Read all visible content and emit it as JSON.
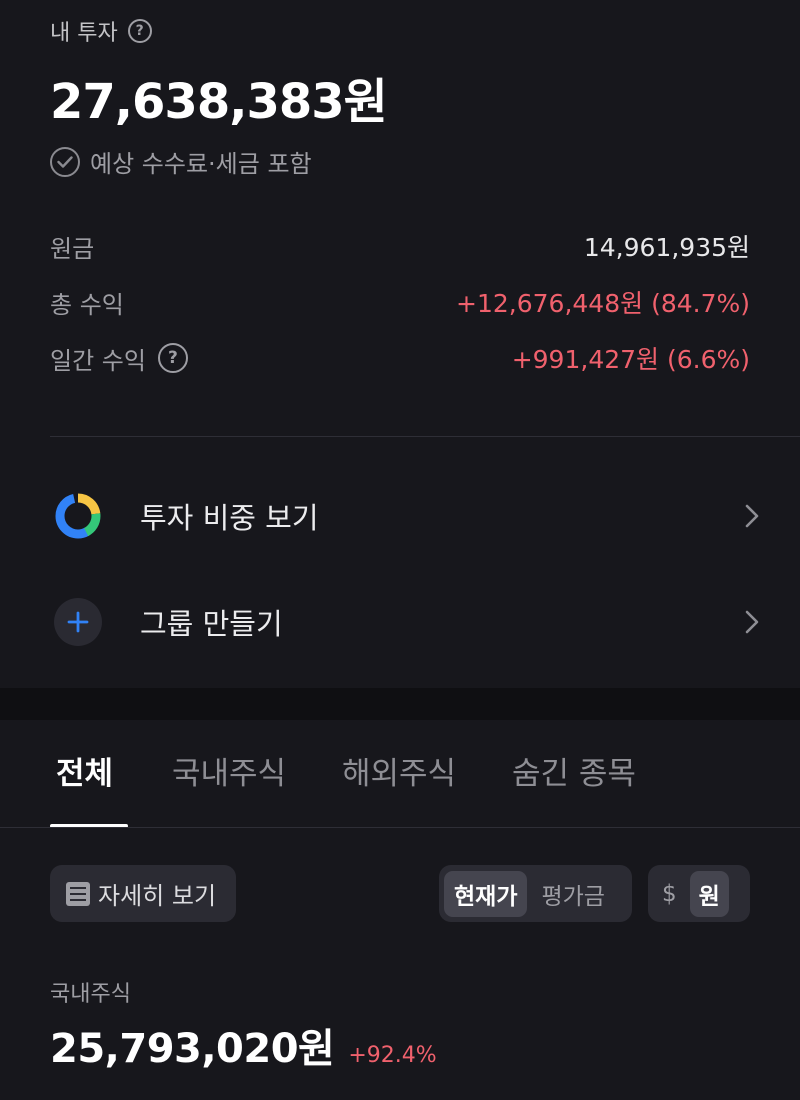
{
  "summary": {
    "title": "내 투자",
    "help_icon": "?",
    "total_value": "27,638,383원",
    "fee_note": "예상 수수료·세금 포함",
    "stats": [
      {
        "label": "원금",
        "value": "14,961,935원"
      },
      {
        "label": "총 수익",
        "value": "+12,676,448원 (84.7%)"
      },
      {
        "label": "일간 수익",
        "value": "+991,427원 (6.6%)"
      }
    ]
  },
  "menu": [
    {
      "label": "투자 비중 보기",
      "icon": "donut-chart-icon"
    },
    {
      "label": "그룹 만들기",
      "icon": "plus-icon"
    }
  ],
  "tabs": [
    "전체",
    "국내주식",
    "해외주식",
    "숨긴 종목"
  ],
  "active_tab": "전체",
  "toolbar": {
    "detail_label": "자세히 보기",
    "price_toggle": [
      "현재가",
      "평가금"
    ],
    "price_toggle_selected": "현재가",
    "currency_toggle": [
      "$",
      "원"
    ],
    "currency_toggle_selected": "원"
  },
  "domestic": {
    "label": "국내주식",
    "value": "25,793,020원",
    "change": "+92.4%"
  },
  "colors": {
    "background": "#17171c",
    "band": "#0f0f12",
    "positive": "#f0616d",
    "accent_blue": "#3182f6",
    "donut_yellow": "#f7c544",
    "donut_green": "#34c779"
  }
}
